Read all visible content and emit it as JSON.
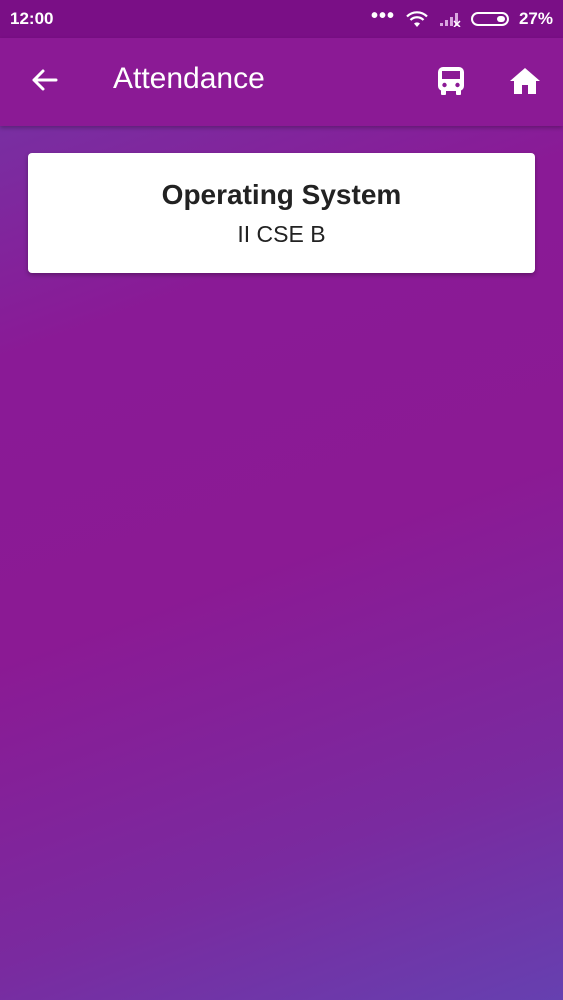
{
  "status": {
    "time": "12:00",
    "battery": "27%"
  },
  "appbar": {
    "title": "Attendance",
    "back_icon": "arrow-left-icon",
    "bus_icon": "bus-icon",
    "home_icon": "home-icon"
  },
  "card": {
    "subject": "Operating System",
    "class": "II CSE B"
  }
}
